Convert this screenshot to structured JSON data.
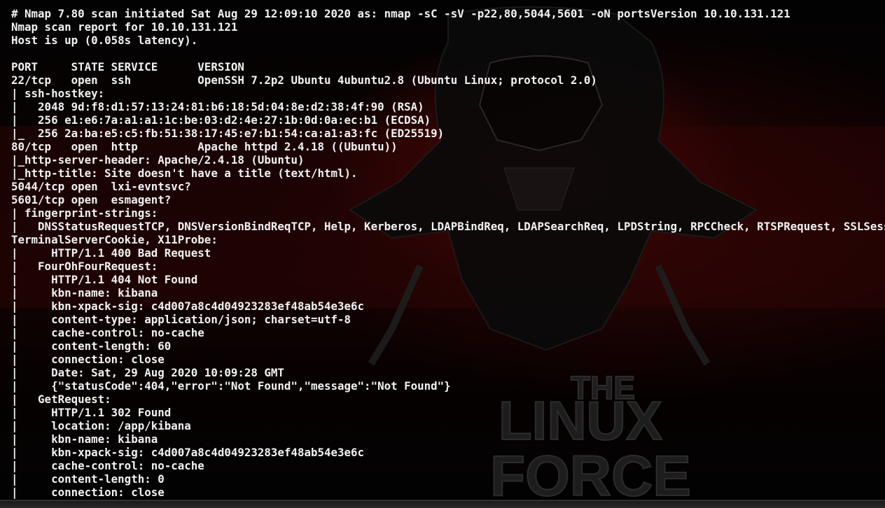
{
  "terminal": {
    "lines": [
      "# Nmap 7.80 scan initiated Sat Aug 29 12:09:10 2020 as: nmap -sC -sV -p22,80,5044,5601 -oN portsVersion 10.10.131.121",
      "Nmap scan report for 10.10.131.121",
      "Host is up (0.058s latency).",
      "",
      "PORT     STATE SERVICE      VERSION",
      "22/tcp   open  ssh          OpenSSH 7.2p2 Ubuntu 4ubuntu2.8 (Ubuntu Linux; protocol 2.0)",
      "| ssh-hostkey:",
      "|   2048 9d:f8:d1:57:13:24:81:b6:18:5d:04:8e:d2:38:4f:90 (RSA)",
      "|   256 e1:e6:7a:a1:a1:1c:be:03:d2:4e:27:1b:0d:0a:ec:b1 (ECDSA)",
      "|_  256 2a:ba:e5:c5:fb:51:38:17:45:e7:b1:54:ca:a1:a3:fc (ED25519)",
      "80/tcp   open  http         Apache httpd 2.4.18 ((Ubuntu))",
      "|_http-server-header: Apache/2.4.18 (Ubuntu)",
      "|_http-title: Site doesn't have a title (text/html).",
      "5044/tcp open  lxi-evntsvc?",
      "5601/tcp open  esmagent?",
      "| fingerprint-strings:",
      "|   DNSStatusRequestTCP, DNSVersionBindReqTCP, Help, Kerberos, LDAPBindReq, LDAPSearchReq, LPDString, RPCCheck, RTSPRequest, SSLSessionReq,",
      "TerminalServerCookie, X11Probe:",
      "|     HTTP/1.1 400 Bad Request",
      "|   FourOhFourRequest:",
      "|     HTTP/1.1 404 Not Found",
      "|     kbn-name: kibana",
      "|     kbn-xpack-sig: c4d007a8c4d04923283ef48ab54e3e6c",
      "|     content-type: application/json; charset=utf-8",
      "|     cache-control: no-cache",
      "|     content-length: 60",
      "|     connection: close",
      "|     Date: Sat, 29 Aug 2020 10:09:28 GMT",
      "|     {\"statusCode\":404,\"error\":\"Not Found\",\"message\":\"Not Found\"}",
      "|   GetRequest:",
      "|     HTTP/1.1 302 Found",
      "|     location: /app/kibana",
      "|     kbn-name: kibana",
      "|     kbn-xpack-sig: c4d007a8c4d04923283ef48ab54e3e6c",
      "|     cache-control: no-cache",
      "|     content-length: 0",
      "|     connection: close"
    ],
    "wallpaper_text": [
      "THE",
      "LINUX",
      "FORCE"
    ],
    "colors": {
      "text": "#f2f2f2",
      "background": "#000000",
      "accent_red": "#7a0a0a"
    }
  }
}
